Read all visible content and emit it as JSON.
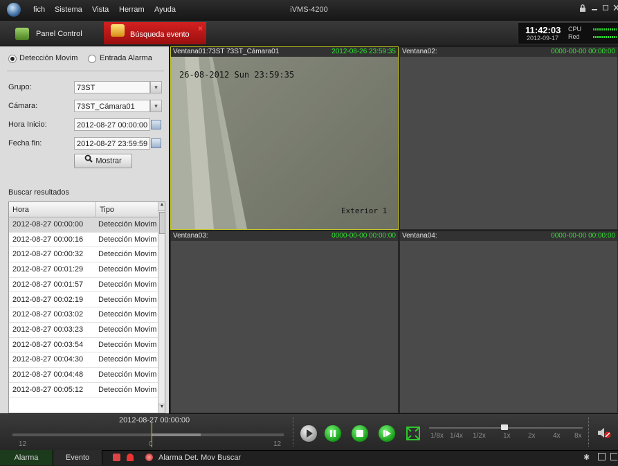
{
  "titlebar": {
    "menu": [
      "fich",
      "Sistema",
      "Vista",
      "Herram",
      "Ayuda"
    ],
    "app_title": "iVMS-4200",
    "controls": [
      "lock-icon",
      "minimize-icon",
      "maximize-icon",
      "close-icon"
    ]
  },
  "tabs": {
    "panel_control": "Panel Control",
    "search_event": "Búsqueda evento"
  },
  "clock": {
    "time": "11:42:03",
    "date": "2012-09-17",
    "cpu_label": "CPU",
    "net_label": "Red"
  },
  "search": {
    "mode_motion": "Detección Movim",
    "mode_alarm": "Entrada Alarma",
    "selected_mode": "Detección Movim",
    "group_label": "Grupo:",
    "group_value": "73ST",
    "camera_label": "Cámara:",
    "camera_value": "73ST_Cámara01",
    "start_label": "Hora Inicio:",
    "start_value": "2012-08-27 00:00:00",
    "end_label": "Fecha fin:",
    "end_value": "2012-08-27 23:59:59",
    "search_button": "Mostrar"
  },
  "results": {
    "title": "Buscar resultados",
    "columns": [
      "Hora",
      "Tipo"
    ],
    "rows": [
      [
        "2012-08-27 00:00:00",
        "Detección Movim"
      ],
      [
        "2012-08-27 00:00:16",
        "Detección Movim"
      ],
      [
        "2012-08-27 00:00:32",
        "Detección Movim"
      ],
      [
        "2012-08-27 00:01:29",
        "Detección Movim"
      ],
      [
        "2012-08-27 00:01:57",
        "Detección Movim"
      ],
      [
        "2012-08-27 00:02:19",
        "Detección Movim"
      ],
      [
        "2012-08-27 00:03:02",
        "Detección Movim"
      ],
      [
        "2012-08-27 00:03:23",
        "Detección Movim"
      ],
      [
        "2012-08-27 00:03:54",
        "Detección Movim"
      ],
      [
        "2012-08-27 00:04:30",
        "Detección Movim"
      ],
      [
        "2012-08-27 00:04:48",
        "Detección Movim"
      ],
      [
        "2012-08-27 00:05:12",
        "Detección Movim"
      ]
    ]
  },
  "windows": [
    {
      "name": "Ventana01:73ST 73ST_Cámara01",
      "time": "2012-08-26 23:59:35",
      "osd_top": "26-08-2012 Sun 23:59:35",
      "osd_bottom": "Exterior 1"
    },
    {
      "name": "Ventana02:",
      "time": "0000-00-00 00:00:00"
    },
    {
      "name": "Ventana03:",
      "time": "0000-00-00 00:00:00"
    },
    {
      "name": "Ventana04:",
      "time": "0000-00-00 00:00:00"
    }
  ],
  "playback": {
    "current_time": "2012-08-27 00:00:00",
    "timeline_left": "12",
    "timeline_mid_label": "0",
    "timeline_right": "12",
    "speeds": [
      "1/8x",
      "1/4x",
      "1/2x",
      "1x",
      "2x",
      "4x",
      "8x"
    ],
    "speed_value": "1x"
  },
  "statusbar": {
    "tab_alarm": "Alarma",
    "tab_event": "Evento",
    "status_text": "Alarma Det. Mov Buscar"
  },
  "colors": {
    "accent_red": "#c41a1a",
    "timestamp_green": "#2ee62e",
    "play_green": "#2ec72e"
  }
}
